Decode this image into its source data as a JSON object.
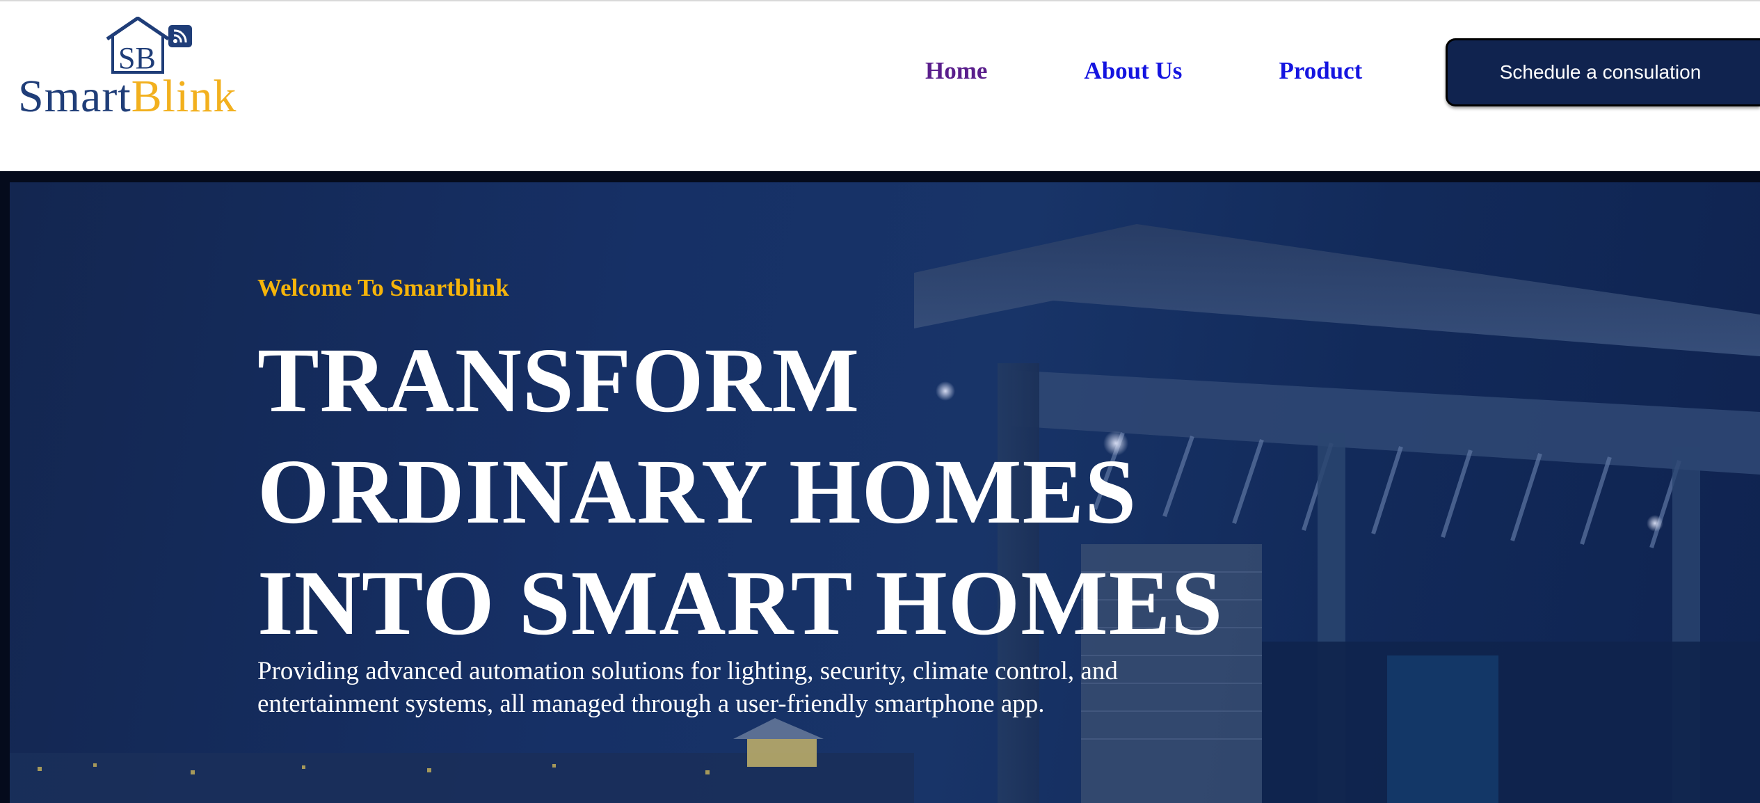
{
  "brand": {
    "monogram": "SB",
    "name_part1": "Smart",
    "name_part2": "Blink",
    "colors": {
      "navy": "#1f3d78",
      "gold": "#f2b01e"
    }
  },
  "nav": {
    "items": [
      {
        "label": "Home",
        "color": "#5a1e8c"
      },
      {
        "label": "About Us",
        "color": "#1414e0"
      },
      {
        "label": "Product",
        "color": "#1414e0"
      }
    ],
    "cta_label": "Schedule a consulation",
    "cta_color": "#10234f"
  },
  "hero": {
    "kicker": "Welcome To Smartblink",
    "title_lines": [
      "TRANSFORM",
      "ORDINARY HOMES",
      "INTO SMART HOMES"
    ],
    "description_lines": [
      "Providing advanced automation solutions for lighting, security, climate control, and",
      "entertainment systems, all managed through a user-friendly smartphone app."
    ],
    "kicker_color": "#f6b40a",
    "background": "night-house-photo"
  }
}
